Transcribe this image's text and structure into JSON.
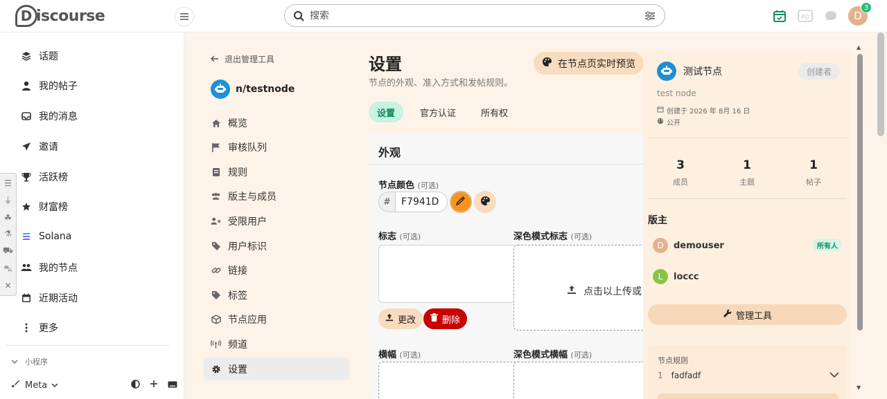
{
  "header": {
    "logo_initial": "D",
    "logo_text": "iscourse",
    "search_placeholder": "搜索",
    "notification_count": "3",
    "avatar_initial": "D"
  },
  "sidebar": {
    "items": [
      {
        "label": "话题",
        "icon": "layers-icon"
      },
      {
        "label": "我的帖子",
        "icon": "user-icon"
      },
      {
        "label": "我的消息",
        "icon": "inbox-icon"
      },
      {
        "label": "邀请",
        "icon": "paper-plane-icon"
      },
      {
        "label": "活跃榜",
        "icon": "trophy-icon"
      },
      {
        "label": "财富榜",
        "icon": "star-icon"
      },
      {
        "label": "Solana",
        "icon": "solana-icon"
      },
      {
        "label": "我的节点",
        "icon": "users-icon"
      },
      {
        "label": "近期活动",
        "icon": "calendar-icon"
      },
      {
        "label": "更多",
        "icon": "more-vertical-icon"
      }
    ],
    "section_label": "小程序",
    "footer_label": "Meta"
  },
  "admin_nav": {
    "back_label": "退出管理工具",
    "node_name": "n/testnode",
    "items": [
      {
        "label": "概览",
        "icon": "home-icon"
      },
      {
        "label": "审核队列",
        "icon": "flag-icon"
      },
      {
        "label": "规则",
        "icon": "rules-icon"
      },
      {
        "label": "版主与成员",
        "icon": "users-icon"
      },
      {
        "label": "受限用户",
        "icon": "user-x-icon"
      },
      {
        "label": "用户标识",
        "icon": "tags-icon"
      },
      {
        "label": "链接",
        "icon": "link-icon"
      },
      {
        "label": "标签",
        "icon": "tag-icon"
      },
      {
        "label": "节点应用",
        "icon": "cube-icon"
      },
      {
        "label": "频道",
        "icon": "broadcast-icon"
      },
      {
        "label": "设置",
        "icon": "gear-icon"
      }
    ]
  },
  "main": {
    "title": "设置",
    "subtitle": "节点的外观、准入方式和发帖规则。",
    "preview_button": "在节点页实时预览",
    "tabs": [
      "设置",
      "官方认证",
      "所有权"
    ],
    "section_title": "外观",
    "color_label": "节点颜色",
    "optional": "(可选)",
    "color_value": "F7941D",
    "color_hash": "#",
    "logo_label": "标志",
    "dark_logo_label": "深色模式标志",
    "upload_text": "点击以上传或",
    "change_button": "更改",
    "delete_button": "删除",
    "banner_label": "横幅",
    "dark_banner_label": "深色模式横幅"
  },
  "info_panel": {
    "node_title": "测试节点",
    "creator_badge": "创建者",
    "description": "test node",
    "created": "创建于 2026 年 8月 16 日",
    "visibility": "公开",
    "stats": [
      {
        "value": "3",
        "label": "成员"
      },
      {
        "value": "1",
        "label": "主题"
      },
      {
        "value": "1",
        "label": "帖子"
      }
    ],
    "moderators_title": "版主",
    "moderators": [
      {
        "name": "demouser",
        "initial": "D",
        "color": "#e3b28c",
        "badge": "所有人"
      },
      {
        "name": "loccc",
        "initial": "L",
        "color": "#8bc34a"
      }
    ],
    "tools_button": "管理工具",
    "rules_label": "节点规则",
    "rules": [
      {
        "index": "1",
        "text": "fadfadf"
      }
    ]
  },
  "colors": {
    "accent_green": "#2ab97a",
    "node_color": "#F7941D",
    "danger": "#c80000",
    "panel_bg": "#fdf3e8"
  }
}
